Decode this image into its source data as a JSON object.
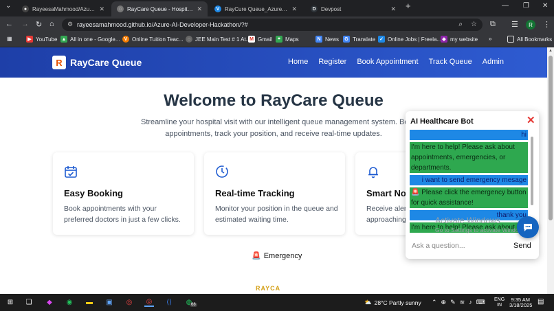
{
  "browser": {
    "tabs": [
      {
        "label": "RayeesaMahmood/Azure-AI-De",
        "favicon": "github-icon",
        "active": false
      },
      {
        "label": "RayCare Queue - Hospital Qu",
        "favicon": "globe-icon",
        "active": true
      },
      {
        "label": "RayCure Queue_Azure-AI-Deve",
        "favicon": "vscode-icon",
        "active": false
      },
      {
        "label": "Devpost",
        "favicon": "devpost-icon",
        "active": false
      }
    ],
    "url": "rayeesamahmood.github.io/Azure-AI-Developer-Hackathon/?#",
    "profile_initial": "R",
    "bookmarks": [
      "YouTube",
      "All in one - Google...",
      "Online Tuition Teac...",
      "JEE Main Test # 1 At...",
      "Gmail",
      "Maps",
      "News",
      "Translate",
      "Online Jobs | Freela...",
      "my website"
    ],
    "all_bookmarks_label": "All Bookmarks"
  },
  "site": {
    "brand": "RayCare Queue",
    "logo_letter": "R",
    "nav": [
      "Home",
      "Register",
      "Book Appointment",
      "Track Queue",
      "Admin"
    ],
    "hero_title": "Welcome to RayCare Queue",
    "hero_subtitle_line1": "Streamline your hospital visit with our intelligent queue management system. Book",
    "hero_subtitle_line2": "appointments, track your position, and receive real-time updates.",
    "cards": [
      {
        "icon": "calendar-check-icon",
        "title": "Easy Booking",
        "desc": "Book appointments with your preferred doctors in just a few clicks."
      },
      {
        "icon": "clock-icon",
        "title": "Real-time Tracking",
        "desc": "Monitor your position in the queue and estimated waiting time."
      },
      {
        "icon": "bell-icon",
        "title": "Smart No",
        "desc": "Receive aler approaching"
      }
    ],
    "emergency_label": "Emergency",
    "partial_logo_text": "RAYCA"
  },
  "chat": {
    "title": "AI Healthcare Bot",
    "messages": [
      {
        "role": "user",
        "text": "hi"
      },
      {
        "role": "bot",
        "text": "I'm here to help! Please ask about appointments, emergencies, or departments."
      },
      {
        "role": "user",
        "text": "i want to send emergency mesage"
      },
      {
        "role": "bot",
        "text": "Please click the emergency button for quick assistance!"
      },
      {
        "role": "user",
        "text": "thank you"
      },
      {
        "role": "bot",
        "text": "I'm here to help! Please ask about"
      }
    ],
    "placeholder": "Ask a question...",
    "send_label": "Send"
  },
  "watermark": {
    "line1": "Activate Windows",
    "line2": "Go to Settings to activate Windows."
  },
  "taskbar": {
    "weather": "28°C  Partly sunny",
    "lang_line1": "ENG",
    "lang_line2": "IN",
    "time": "9:35 AM",
    "date": "3/18/2025",
    "whatsapp_badge": "68"
  },
  "colors": {
    "nav_gradient_start": "#1e3fa8",
    "user_bubble": "#1e88e5",
    "bot_bubble": "#2ea84f",
    "close_red": "#e53935"
  }
}
